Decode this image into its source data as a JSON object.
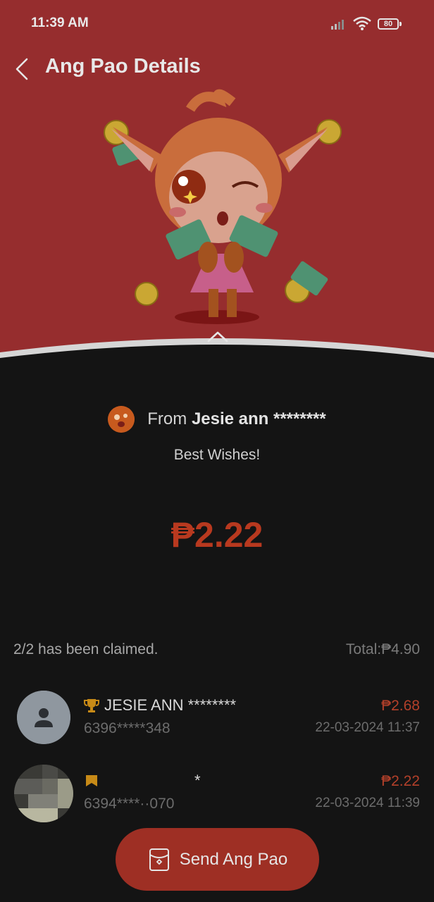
{
  "status_bar": {
    "time": "11:39 AM",
    "battery": "80"
  },
  "header": {
    "title": "Ang Pao Details"
  },
  "sender": {
    "from_label": "From",
    "name": "Jesie ann ********"
  },
  "message": "Best Wishes!",
  "amount": "₱2.22",
  "summary": {
    "claimed": "2/2 has been claimed.",
    "total": "Total:₱4.90"
  },
  "recipients": [
    {
      "name": "JESIE ANN ********",
      "phone": "6396*****348",
      "amount": "₱2.68",
      "date": "22-03-2024 11:37"
    },
    {
      "name": "*",
      "phone": "6394****··070",
      "amount": "₱2.22",
      "date": "22-03-2024 11:39"
    }
  ],
  "send_button": {
    "label": "Send Ang Pao"
  },
  "colors": {
    "header_red": "#962d2e",
    "amount_red": "#b8391f",
    "button_red": "#9e2f24",
    "background": "#141414"
  }
}
